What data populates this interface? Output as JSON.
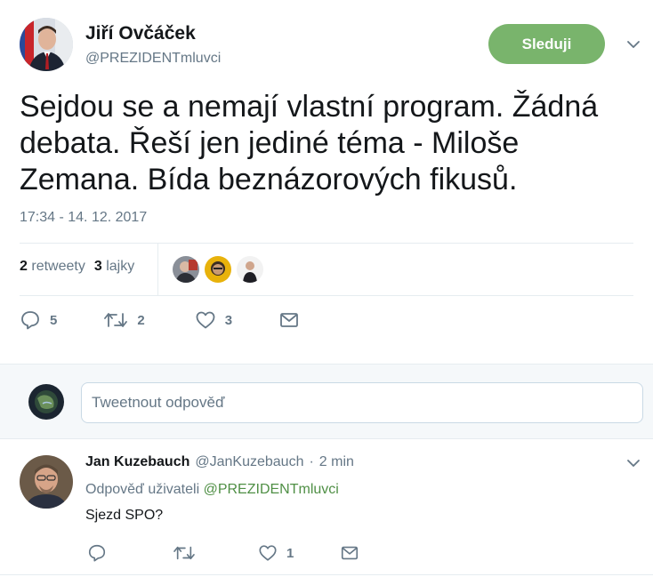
{
  "author": {
    "name": "Jiří Ovčáček",
    "handle": "@PREZIDENTmluvci",
    "follow_label": "Sleduji"
  },
  "tweet": {
    "text": "Sejdou se a nemají vlastní program. Žádná debata. Řeší jen jediné téma -  Miloše Zemana. Bída beznázorových fikusů.",
    "timestamp": "17:34 - 14. 12. 2017"
  },
  "stats": {
    "retweets_count": "2",
    "retweets_label": "retweety",
    "likes_count": "3",
    "likes_label": "lajky"
  },
  "actions": {
    "reply_count": "5",
    "retweet_count": "2",
    "like_count": "3"
  },
  "reply_box": {
    "placeholder": "Tweetnout odpověď"
  },
  "reply": {
    "name": "Jan Kuzebauch",
    "handle": "@JanKuzebauch",
    "separator": "·",
    "time": "2 min",
    "reply_to_prefix": "Odpověď uživateli",
    "reply_to_handle": "@PREZIDENTmluvci",
    "text": "Sjezd SPO?",
    "like_count": "1"
  },
  "colors": {
    "follow_button": "#79b46c",
    "link_green": "#4f8f45",
    "secondary_text": "#657786"
  },
  "icons": [
    "chevron-down-icon",
    "reply-icon",
    "retweet-icon",
    "like-icon",
    "message-icon"
  ]
}
